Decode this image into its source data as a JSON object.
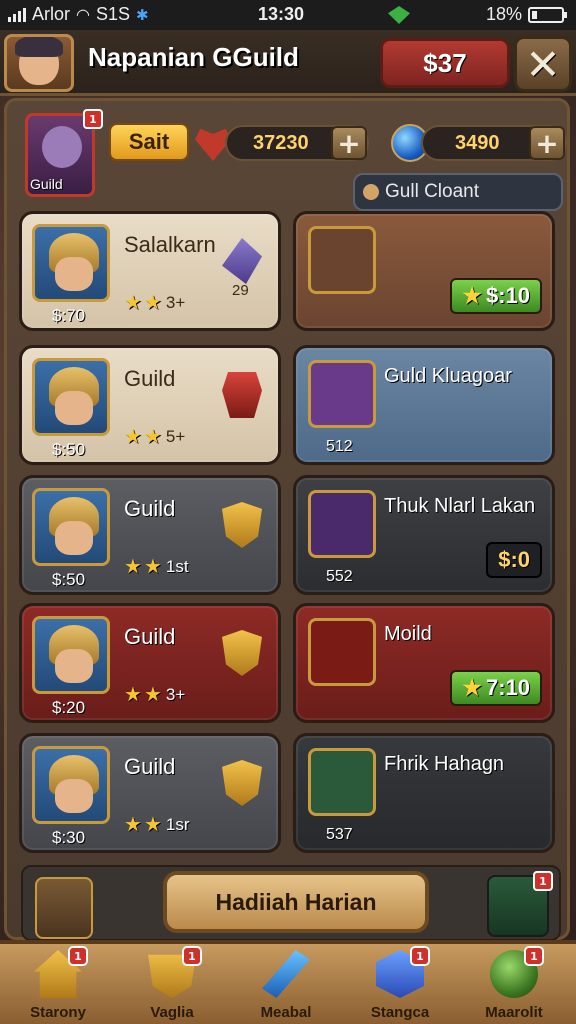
{
  "status_bar": {
    "carrier": "Arlor",
    "network": "S1S",
    "time": "13:30",
    "battery": "18%",
    "battery_level": 0.18
  },
  "header": {
    "title": "Napanian GGuild",
    "red_currency": "$37",
    "close_icon": "close-icon"
  },
  "info": {
    "portrait_label": "Guild",
    "portrait_badge": "1",
    "sait_label": "Sait",
    "resource_1": {
      "icon": "heart-icon",
      "value": "37230"
    },
    "resource_2": {
      "icon": "blue-orb-icon",
      "value": "3490"
    },
    "chat_label": "Gull Cloant"
  },
  "left_cards": [
    {
      "name": "Salalkarn",
      "stars_text": "3+",
      "price": "$:70",
      "sub": "29",
      "color": "beige",
      "item": "gem"
    },
    {
      "name": "Guild",
      "stars_text": "5+",
      "price": "$:50",
      "sub": "",
      "color": "beige",
      "item": "red"
    },
    {
      "name": "Guild",
      "stars_text": "1st",
      "price": "$:50",
      "sub": "",
      "color": "gray",
      "item": "shield"
    },
    {
      "name": "Guild",
      "stars_text": "3+",
      "price": "$:20",
      "sub": "",
      "color": "red",
      "item": "shield"
    },
    {
      "name": "Guild",
      "stars_text": "1sr",
      "price": "$:30",
      "sub": "",
      "color": "gray",
      "item": "shield"
    }
  ],
  "right_cards": [
    {
      "name": "",
      "count": "",
      "price": "$:10",
      "color": "brown",
      "pill": "green"
    },
    {
      "name": "Guld Kluagoar",
      "count": "512",
      "price": "",
      "color": "blue",
      "pill": ""
    },
    {
      "name": "Thuk Nlarl Lakan",
      "count": "552",
      "price": "$:0",
      "color": "dark",
      "pill": "dark"
    },
    {
      "name": "Moild",
      "count": "",
      "price": "7:10",
      "color": "red",
      "pill": "green"
    },
    {
      "name": "Fhrik Hahagn",
      "count": "537",
      "price": "",
      "color": "darkteal",
      "pill": ""
    }
  ],
  "reward": {
    "label": "Hadiiah Harian",
    "badge": "1"
  },
  "bottom_nav": [
    {
      "label": "Starony",
      "icon": "house-icon",
      "badge": "1"
    },
    {
      "label": "Vaglia",
      "icon": "shield-icon",
      "badge": "1"
    },
    {
      "label": "Meabal",
      "icon": "blade-icon",
      "badge": ""
    },
    {
      "label": "Stangca",
      "icon": "cube-icon",
      "badge": "1"
    },
    {
      "label": "Maarolit",
      "icon": "orb-icon",
      "badge": "1"
    }
  ]
}
